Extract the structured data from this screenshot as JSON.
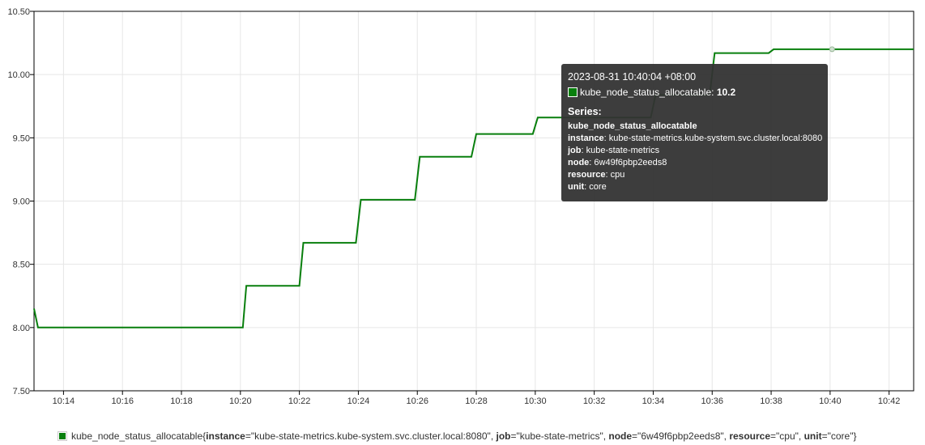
{
  "chart_data": {
    "type": "line",
    "title": "",
    "xlabel": "",
    "ylabel": "",
    "xlim": [
      "10:13:00",
      "10:42:50"
    ],
    "ylim": [
      7.5,
      10.5
    ],
    "yticks": [
      "7.50",
      "8.00",
      "8.50",
      "9.00",
      "9.50",
      "10.00",
      "10.50"
    ],
    "xticks": [
      "10:14",
      "10:16",
      "10:18",
      "10:20",
      "10:22",
      "10:24",
      "10:26",
      "10:28",
      "10:30",
      "10:32",
      "10:34",
      "10:36",
      "10:38",
      "10:40",
      "10:42"
    ],
    "grid": true,
    "series": [
      {
        "name": "kube_node_status_allocatable",
        "color": "#087f0d",
        "points": [
          [
            "10:13:00",
            8.15
          ],
          [
            "10:13:08",
            8.0
          ],
          [
            "10:20:05",
            8.0
          ],
          [
            "10:20:12",
            8.33
          ],
          [
            "10:22:00",
            8.33
          ],
          [
            "10:22:08",
            8.67
          ],
          [
            "10:23:55",
            8.67
          ],
          [
            "10:24:05",
            9.01
          ],
          [
            "10:25:55",
            9.01
          ],
          [
            "10:26:05",
            9.35
          ],
          [
            "10:27:50",
            9.35
          ],
          [
            "10:28:00",
            9.53
          ],
          [
            "10:29:55",
            9.53
          ],
          [
            "10:30:05",
            9.66
          ],
          [
            "10:33:55",
            9.66
          ],
          [
            "10:34:05",
            9.84
          ],
          [
            "10:35:55",
            9.84
          ],
          [
            "10:36:05",
            10.17
          ],
          [
            "10:37:55",
            10.17
          ],
          [
            "10:38:05",
            10.2
          ],
          [
            "10:42:50",
            10.2
          ]
        ]
      }
    ],
    "hover_point": [
      "10:40:04",
      10.2
    ]
  },
  "tooltip": {
    "time": "2023-08-31 10:40:04 +08:00",
    "metric": "kube_node_status_allocatable:",
    "value": "10.2",
    "series_header": "Series:",
    "series_name": "kube_node_status_allocatable",
    "labels": [
      {
        "key": "instance",
        "value": "kube-state-metrics.kube-system.svc.cluster.local:8080"
      },
      {
        "key": "job",
        "value": "kube-state-metrics"
      },
      {
        "key": "node",
        "value": "6w49f6pbp2eeds8"
      },
      {
        "key": "resource",
        "value": "cpu"
      },
      {
        "key": "unit",
        "value": "core"
      }
    ]
  },
  "legend": {
    "name": "kube_node_status_allocatable",
    "open": "{",
    "close": "}",
    "labels": [
      {
        "key": "instance",
        "value": "\"kube-state-metrics.kube-system.svc.cluster.local:8080\""
      },
      {
        "key": "job",
        "value": "\"kube-state-metrics\""
      },
      {
        "key": "node",
        "value": "\"6w49f6pbp2eeds8\""
      },
      {
        "key": "resource",
        "value": "\"cpu\""
      },
      {
        "key": "unit",
        "value": "\"core\""
      }
    ]
  }
}
